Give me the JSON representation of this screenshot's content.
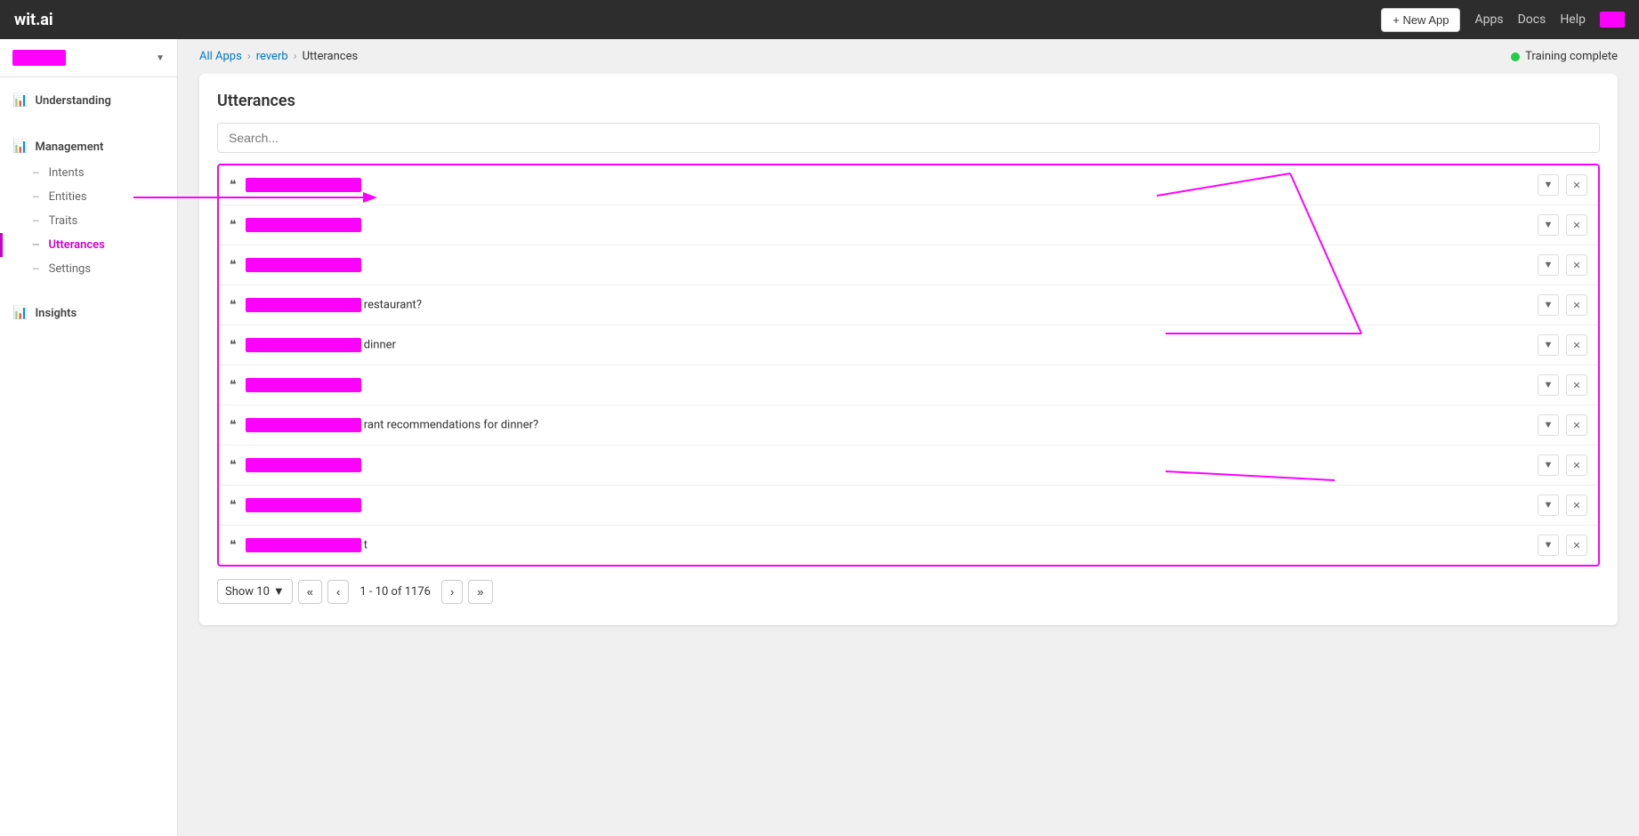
{
  "app": {
    "logo": "wit.ai",
    "title": "wit.ai"
  },
  "topnav": {
    "new_app_label": "+ New App",
    "apps_label": "Apps",
    "docs_label": "Docs",
    "help_label": "Help"
  },
  "sidebar": {
    "app_name_redacted": true,
    "sections": [
      {
        "id": "understanding",
        "label": "Understanding",
        "icon": "📊"
      },
      {
        "id": "management",
        "label": "Management",
        "icon": "📊",
        "items": [
          {
            "id": "intents",
            "label": "Intents",
            "active": false
          },
          {
            "id": "entities",
            "label": "Entities",
            "active": false
          },
          {
            "id": "traits",
            "label": "Traits",
            "active": false
          },
          {
            "id": "utterances",
            "label": "Utterances",
            "active": true
          },
          {
            "id": "settings",
            "label": "Settings",
            "active": false
          }
        ]
      },
      {
        "id": "insights",
        "label": "Insights",
        "icon": "📊"
      }
    ]
  },
  "breadcrumb": {
    "all_apps": "All Apps",
    "app_name": "reverb",
    "current": "Utterances"
  },
  "training_status": {
    "label": "Training complete",
    "status": "complete"
  },
  "page_title": "Utterances",
  "search": {
    "placeholder": "Search..."
  },
  "utterances": {
    "rows": [
      {
        "id": 1,
        "text_visible": "",
        "redacted": true
      },
      {
        "id": 2,
        "text_visible": "",
        "redacted": true
      },
      {
        "id": 3,
        "text_visible": "",
        "redacted": true
      },
      {
        "id": 4,
        "text_visible": "restaurant?",
        "redacted": true
      },
      {
        "id": 5,
        "text_visible": "dinner",
        "redacted": true
      },
      {
        "id": 6,
        "text_visible": "",
        "redacted": true
      },
      {
        "id": 7,
        "text_visible": "rant recommendations for dinner?",
        "redacted": true
      },
      {
        "id": 8,
        "text_visible": "",
        "redacted": true
      },
      {
        "id": 9,
        "text_visible": "",
        "redacted": true
      },
      {
        "id": 10,
        "text_visible": "t",
        "redacted": true
      }
    ]
  },
  "pagination": {
    "show_label": "Show 10",
    "range_label": "1 - 10 of 1176",
    "first_btn": "«",
    "prev_btn": "‹",
    "next_btn": "›",
    "last_btn": "»"
  }
}
